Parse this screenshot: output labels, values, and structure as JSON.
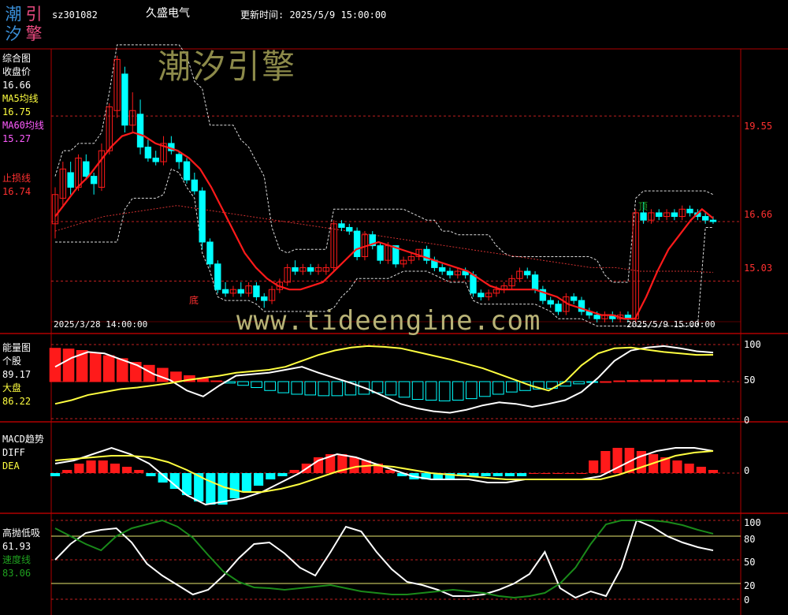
{
  "app": {
    "logo_chars": [
      "潮",
      "引",
      "汐",
      "擎"
    ],
    "stock_code": "sz301082",
    "stock_name": "久盛电气",
    "update_time": "更新时间: 2025/5/9 15:00:00",
    "watermark_cn": "潮汐引擎",
    "watermark_url": "www.tideengine.com"
  },
  "panel_main": {
    "title": "综合图",
    "close_label": "收盘价",
    "close_value": "16.66",
    "ma5_label": "MA5均线",
    "ma5_value": "16.75",
    "ma60_label": "MA60均线",
    "ma60_value": "15.27",
    "stop_label": "止损线",
    "stop_value": "16.74",
    "y_ticks": [
      "19.55",
      "16.66",
      "15.03"
    ],
    "date_start": "2025/3/28 14:00:00",
    "date_end": "2025/5/9 15:00:00",
    "bottom_mark": "底",
    "top_mark": "顶"
  },
  "panel_energy": {
    "title": "能量图",
    "stock_label": "个股",
    "stock_value": "89.17",
    "market_label": "大盘",
    "market_value": "86.22",
    "y_ticks": [
      "100",
      "50",
      "0"
    ]
  },
  "panel_macd": {
    "title": "MACD趋势",
    "diff_label": "DIFF",
    "dea_label": "DEA",
    "y_ticks": [
      "0"
    ]
  },
  "panel_osc": {
    "title": "高抛低吸",
    "value": "61.93",
    "speed_label": "速度线",
    "speed_value": "83.06",
    "y_ticks": [
      "100",
      "80",
      "50",
      "20",
      "0"
    ]
  },
  "colors": {
    "up": "#ff1a1a",
    "down": "#00ffff",
    "ma5": "#ffffff",
    "ma60": "#ff4040",
    "yellow": "#ffff40",
    "green": "#1a8a1a",
    "border": "#b00000",
    "magenta": "#ff5cff"
  },
  "chart_data": [
    {
      "type": "candlestick",
      "title": "综合图",
      "ylim": [
        14.2,
        21.0
      ],
      "y_ticks": [
        19.55,
        16.66,
        15.03
      ],
      "candles": [
        [
          16.6,
          17.4,
          16.2,
          17.6
        ],
        [
          17.3,
          18.1,
          17.1,
          18.3
        ],
        [
          18.0,
          17.6,
          17.4,
          18.3
        ],
        [
          17.6,
          18.4,
          17.5,
          18.5
        ],
        [
          18.3,
          17.9,
          17.8,
          18.5
        ],
        [
          17.9,
          17.7,
          17.4,
          18.0
        ],
        [
          17.6,
          18.6,
          17.5,
          18.8
        ],
        [
          18.6,
          19.8,
          18.5,
          19.9
        ],
        [
          19.7,
          21.1,
          19.5,
          21.2
        ],
        [
          20.7,
          19.3,
          19.1,
          20.9
        ],
        [
          19.3,
          19.7,
          19.1,
          20.2
        ],
        [
          19.6,
          18.7,
          18.5,
          20.0
        ],
        [
          18.7,
          18.4,
          18.3,
          18.9
        ],
        [
          18.4,
          18.3,
          18.2,
          18.6
        ],
        [
          18.3,
          18.8,
          18.2,
          19.0
        ],
        [
          18.8,
          18.6,
          18.5,
          19.0
        ],
        [
          18.5,
          18.3,
          18.1,
          18.6
        ],
        [
          18.3,
          17.8,
          17.7,
          18.4
        ],
        [
          17.8,
          17.5,
          17.4,
          18.0
        ],
        [
          17.5,
          16.1,
          15.9,
          17.6
        ],
        [
          16.1,
          15.5,
          15.4,
          16.2
        ],
        [
          15.5,
          14.8,
          14.7,
          15.6
        ],
        [
          14.8,
          14.7,
          14.6,
          15.0
        ],
        [
          14.7,
          14.8,
          14.6,
          14.9
        ],
        [
          14.8,
          14.7,
          14.6,
          15.0
        ],
        [
          14.7,
          14.9,
          14.6,
          15.0
        ],
        [
          14.9,
          14.6,
          14.5,
          15.0
        ],
        [
          14.6,
          14.5,
          14.3,
          14.7
        ],
        [
          14.5,
          14.8,
          14.4,
          14.9
        ],
        [
          14.8,
          15.0,
          14.7,
          15.1
        ],
        [
          15.0,
          15.4,
          14.9,
          15.5
        ],
        [
          15.4,
          15.3,
          15.2,
          15.6
        ],
        [
          15.3,
          15.4,
          15.2,
          15.5
        ],
        [
          15.4,
          15.3,
          15.2,
          15.5
        ],
        [
          15.3,
          15.4,
          15.2,
          15.5
        ],
        [
          15.3,
          15.4,
          15.2,
          15.5
        ],
        [
          15.4,
          16.6,
          15.3,
          16.7
        ],
        [
          16.6,
          16.5,
          16.4,
          16.7
        ],
        [
          16.5,
          16.4,
          16.3,
          16.6
        ],
        [
          16.4,
          15.7,
          15.6,
          16.5
        ],
        [
          15.7,
          16.3,
          15.6,
          16.4
        ],
        [
          16.3,
          16.0,
          15.9,
          16.4
        ],
        [
          16.0,
          15.6,
          15.5,
          16.1
        ],
        [
          15.6,
          16.0,
          15.5,
          16.1
        ],
        [
          16.0,
          15.5,
          15.4,
          16.0
        ],
        [
          15.5,
          15.6,
          15.4,
          15.7
        ],
        [
          15.6,
          15.7,
          15.5,
          15.8
        ],
        [
          15.7,
          15.9,
          15.6,
          15.9
        ],
        [
          15.9,
          15.6,
          15.5,
          16.0
        ],
        [
          15.6,
          15.4,
          15.3,
          15.7
        ],
        [
          15.4,
          15.3,
          15.2,
          15.5
        ],
        [
          15.3,
          15.2,
          15.1,
          15.4
        ],
        [
          15.2,
          15.3,
          15.1,
          15.4
        ],
        [
          15.3,
          15.2,
          15.1,
          15.4
        ],
        [
          15.2,
          14.7,
          14.6,
          15.3
        ],
        [
          14.7,
          14.6,
          14.5,
          14.8
        ],
        [
          14.6,
          14.7,
          14.5,
          14.8
        ],
        [
          14.7,
          14.8,
          14.6,
          14.9
        ],
        [
          14.8,
          14.9,
          14.7,
          15.0
        ],
        [
          14.9,
          15.1,
          14.8,
          15.2
        ],
        [
          15.1,
          15.3,
          15.0,
          15.4
        ],
        [
          15.3,
          15.2,
          15.1,
          15.4
        ],
        [
          15.2,
          14.8,
          14.7,
          15.3
        ],
        [
          14.8,
          14.5,
          14.4,
          14.9
        ],
        [
          14.5,
          14.4,
          14.3,
          14.6
        ],
        [
          14.4,
          14.2,
          14.1,
          14.5
        ],
        [
          14.2,
          14.6,
          14.1,
          14.7
        ],
        [
          14.6,
          14.5,
          14.4,
          14.7
        ],
        [
          14.5,
          14.2,
          14.1,
          14.6
        ],
        [
          14.2,
          14.1,
          14.0,
          14.3
        ],
        [
          14.1,
          14.0,
          13.9,
          14.2
        ],
        [
          14.0,
          14.1,
          13.9,
          14.2
        ],
        [
          14.1,
          14.0,
          13.9,
          14.2
        ],
        [
          14.0,
          14.1,
          13.9,
          14.2
        ],
        [
          14.1,
          14.0,
          13.9,
          14.2
        ],
        [
          14.0,
          16.9,
          13.9,
          17.0
        ],
        [
          16.9,
          16.7,
          16.6,
          17.2
        ],
        [
          16.7,
          16.9,
          16.6,
          17.0
        ],
        [
          16.9,
          16.8,
          16.7,
          17.0
        ],
        [
          16.8,
          16.9,
          16.7,
          17.0
        ],
        [
          16.9,
          16.8,
          16.7,
          17.0
        ],
        [
          16.8,
          17.0,
          16.7,
          17.1
        ],
        [
          17.0,
          16.9,
          16.8,
          17.1
        ],
        [
          16.9,
          16.8,
          16.7,
          17.0
        ],
        [
          16.8,
          16.7,
          16.6,
          16.9
        ],
        [
          16.7,
          16.66,
          16.6,
          16.8
        ]
      ],
      "ma5": [
        16.8,
        17.2,
        17.6,
        17.9,
        18.3,
        18.7,
        19.0,
        19.1,
        19.0,
        18.8,
        18.7,
        18.6,
        18.4,
        18.1,
        17.6,
        17.0,
        16.4,
        15.8,
        15.4,
        15.1,
        14.9,
        14.8,
        14.8,
        14.9,
        15.0,
        15.3,
        15.6,
        15.9,
        16.0,
        16.1,
        16.0,
        15.9,
        15.8,
        15.7,
        15.6,
        15.5,
        15.4,
        15.3,
        15.1,
        14.9,
        14.8,
        14.8,
        14.8,
        14.8,
        14.7,
        14.6,
        14.4,
        14.3,
        14.2,
        14.1,
        14.1,
        14.0,
        14.0,
        14.6,
        15.3,
        15.9,
        16.3,
        16.7,
        17.0,
        16.75
      ],
      "ma60": [
        16.4,
        16.6,
        16.8,
        16.9,
        17.0,
        17.1,
        17.0,
        16.9,
        16.8,
        16.7,
        16.6,
        16.5,
        16.4,
        16.3,
        16.2,
        16.1,
        16.0,
        15.9,
        15.8,
        15.7,
        15.6,
        15.5,
        15.4,
        15.4,
        15.3,
        15.3,
        15.3,
        15.27
      ]
    },
    {
      "type": "bar+line",
      "title": "能量图",
      "ylim": [
        0,
        100
      ],
      "y_ticks": [
        100,
        50,
        0
      ],
      "series": [
        {
          "name": "个股",
          "values": [
            70,
            82,
            90,
            88,
            80,
            72,
            60,
            52,
            38,
            30,
            45,
            58,
            60,
            62,
            66,
            70,
            62,
            55,
            48,
            40,
            30,
            20,
            14,
            10,
            8,
            12,
            18,
            22,
            20,
            16,
            20,
            25,
            36,
            55,
            78,
            92,
            96,
            98,
            95,
            91,
            89.17
          ]
        },
        {
          "name": "大盘",
          "values": [
            20,
            25,
            32,
            36,
            40,
            42,
            45,
            48,
            52,
            55,
            58,
            62,
            64,
            66,
            70,
            78,
            86,
            92,
            96,
            98,
            97,
            95,
            90,
            85,
            80,
            74,
            68,
            60,
            52,
            44,
            38,
            50,
            72,
            88,
            95,
            96,
            93,
            90,
            88,
            86,
            86.22
          ]
        }
      ],
      "bars": [
        90,
        88,
        84,
        78,
        70,
        62,
        52,
        44,
        36,
        26,
        16,
        8,
        2,
        -4,
        -10,
        -16,
        -24,
        -30,
        -34,
        -36,
        -38,
        -38,
        -36,
        -34,
        -30,
        -36,
        -42,
        -48,
        -50,
        -52,
        -50,
        -46,
        -40,
        -34,
        -28,
        -24,
        -20,
        -18,
        -12,
        -6,
        -2,
        0,
        2,
        3,
        4,
        4,
        4,
        4,
        3,
        3
      ]
    },
    {
      "type": "bar+line",
      "title": "MACD趋势",
      "series": [
        {
          "name": "DIFF",
          "values": [
            0.3,
            0.4,
            0.6,
            0.8,
            0.6,
            0.3,
            -0.2,
            -0.7,
            -1.0,
            -0.9,
            -0.8,
            -0.6,
            -0.3,
            0.0,
            0.4,
            0.6,
            0.5,
            0.3,
            0.1,
            -0.1,
            -0.2,
            -0.2,
            -0.2,
            -0.3,
            -0.3,
            -0.2,
            -0.2,
            -0.2,
            -0.2,
            -0.1,
            0.2,
            0.5,
            0.7,
            0.8,
            0.8,
            0.7
          ]
        },
        {
          "name": "DEA",
          "values": [
            0.4,
            0.45,
            0.5,
            0.55,
            0.55,
            0.5,
            0.35,
            0.1,
            -0.2,
            -0.45,
            -0.6,
            -0.6,
            -0.5,
            -0.35,
            -0.15,
            0.05,
            0.2,
            0.25,
            0.2,
            0.1,
            0.0,
            -0.05,
            -0.1,
            -0.15,
            -0.2,
            -0.2,
            -0.2,
            -0.2,
            -0.2,
            -0.2,
            -0.05,
            0.15,
            0.35,
            0.55,
            0.65,
            0.7
          ]
        }
      ],
      "bars": [
        -0.1,
        0.1,
        0.3,
        0.4,
        0.4,
        0.3,
        0.2,
        0.1,
        -0.1,
        -0.3,
        -0.5,
        -0.7,
        -0.9,
        -1.0,
        -1.0,
        -0.8,
        -0.6,
        -0.4,
        -0.2,
        -0.1,
        0.1,
        0.3,
        0.5,
        0.6,
        0.6,
        0.5,
        0.4,
        0.3,
        0.1,
        -0.1,
        -0.2,
        -0.2,
        -0.2,
        -0.2,
        -0.1,
        -0.1,
        -0.1,
        -0.1,
        -0.1,
        -0.1,
        0.0,
        0.0,
        0.0,
        0.0,
        0.0,
        0.4,
        0.7,
        0.8,
        0.8,
        0.7,
        0.6,
        0.5,
        0.4,
        0.3,
        0.2,
        0.1
      ]
    },
    {
      "type": "line",
      "title": "高抛低吸",
      "ylim": [
        0,
        100
      ],
      "y_ticks": [
        100,
        80,
        50,
        20,
        0
      ],
      "series": [
        {
          "name": "高抛低吸",
          "values": [
            50,
            70,
            84,
            88,
            90,
            72,
            45,
            30,
            18,
            6,
            12,
            30,
            52,
            70,
            72,
            58,
            40,
            30,
            60,
            92,
            86,
            60,
            38,
            22,
            18,
            12,
            4,
            4,
            6,
            12,
            20,
            32,
            60,
            14,
            2,
            10,
            4,
            40,
            100,
            92,
            80,
            72,
            66,
            61.93
          ]
        },
        {
          "name": "速度线",
          "values": [
            90,
            80,
            70,
            62,
            80,
            90,
            95,
            100,
            92,
            78,
            56,
            35,
            22,
            15,
            14,
            12,
            14,
            16,
            18,
            14,
            10,
            8,
            6,
            6,
            8,
            10,
            12,
            10,
            8,
            4,
            2,
            4,
            8,
            20,
            40,
            70,
            95,
            100,
            100,
            100,
            98,
            94,
            88,
            83.06
          ]
        }
      ]
    }
  ]
}
